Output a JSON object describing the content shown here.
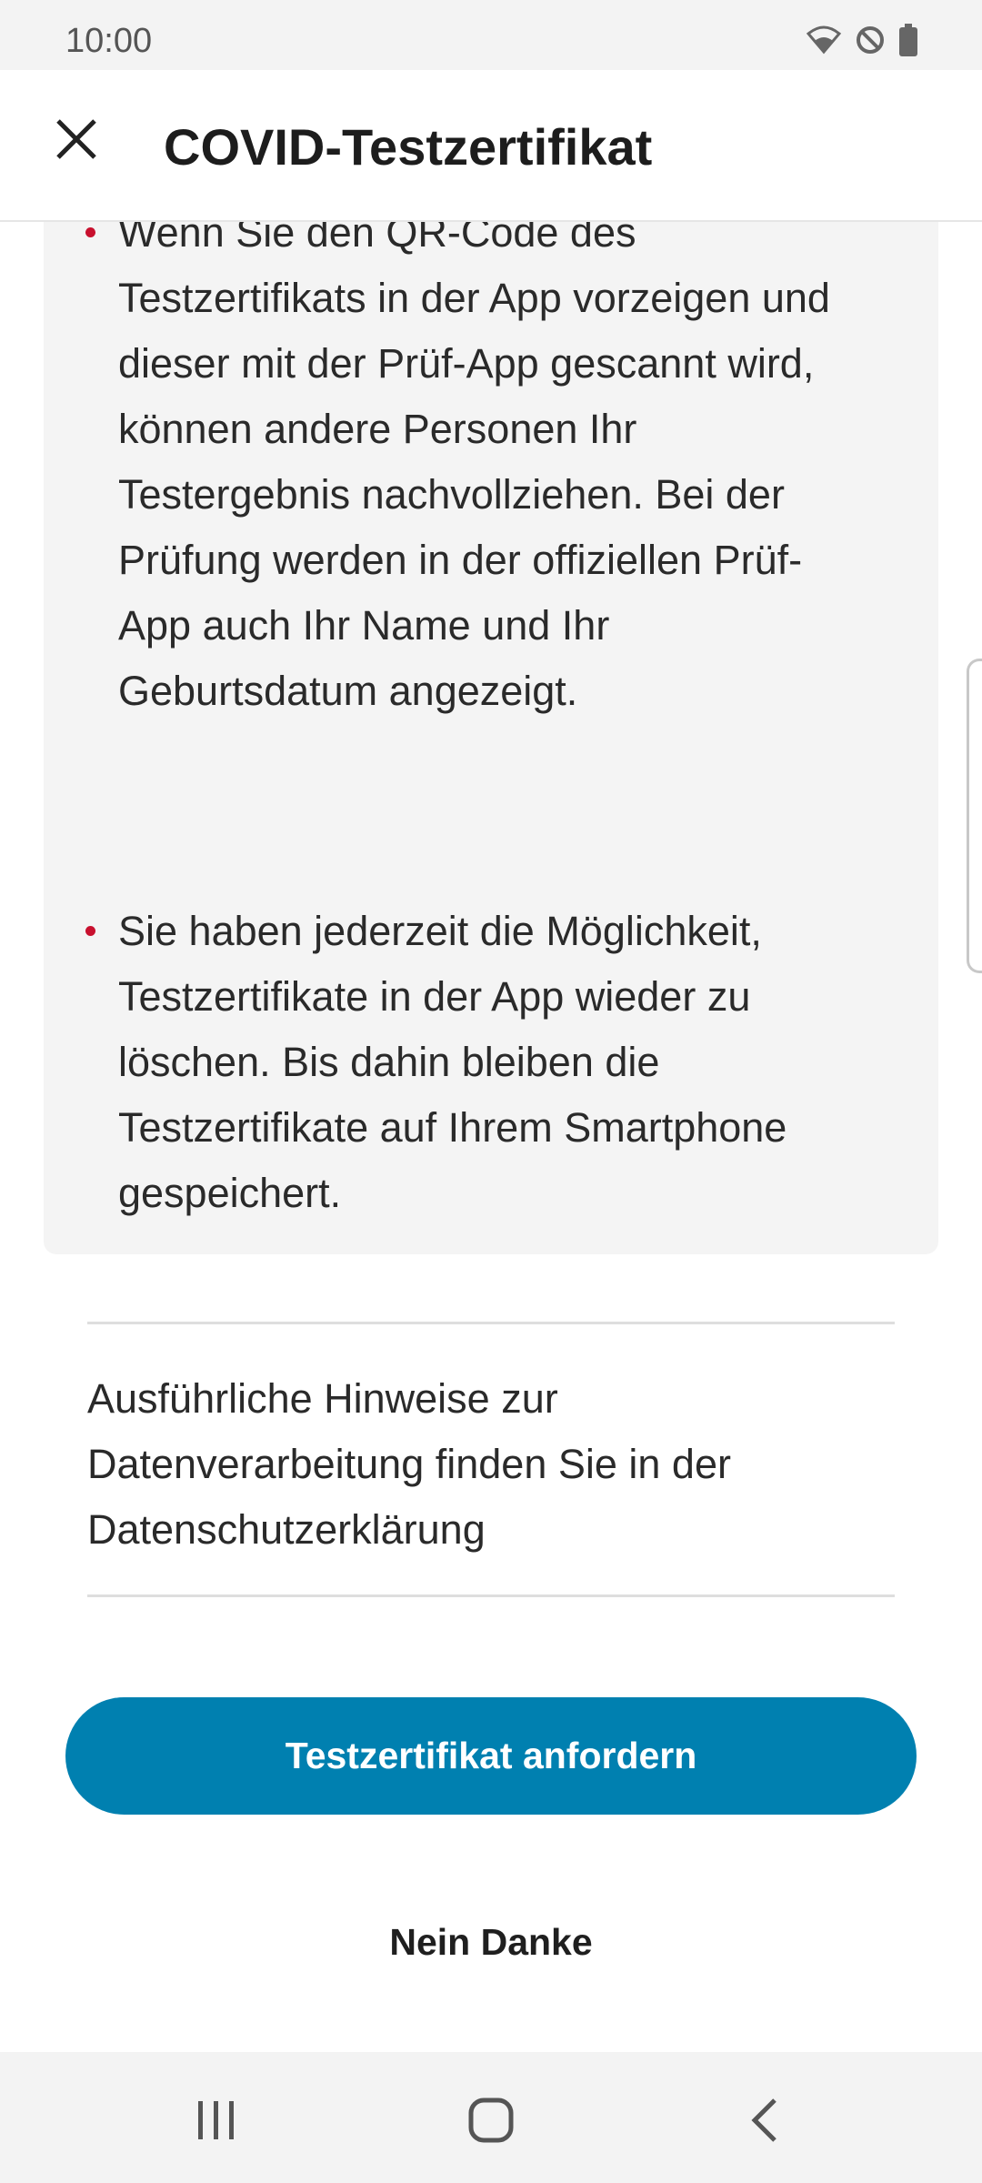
{
  "status_bar": {
    "time": "10:00",
    "icons": [
      "wifi-icon",
      "do-not-disturb-icon",
      "battery-icon"
    ]
  },
  "app_bar": {
    "title": "COVID-Testzertifikat",
    "close_icon": "close-icon"
  },
  "info_box": {
    "bullets": [
      "Wenn Sie den QR-Code des Testzertifikats in der App vorzeigen und dieser mit der Prüf-App gescannt wird, können andere Personen Ihr Testergebnis nachvollziehen. Bei der Prüfung werden in der offiziellen Prüf-App auch Ihr Name und Ihr Geburtsdatum angezeigt.",
      "Sie haben jederzeit die Möglichkeit, Testzertifikate in der App wieder zu löschen. Bis dahin bleiben die Testzertifikate auf Ihrem Smartphone gespeichert."
    ]
  },
  "privacy_link": {
    "text": "Ausführliche Hinweise zur Datenverarbeitung finden Sie in der Datenschutzerklärung"
  },
  "actions": {
    "primary_label": "Testzertifikat anfordern",
    "secondary_label": "Nein Danke"
  },
  "colors": {
    "accent": "#0080b0",
    "bullet": "#c8102e",
    "box_background": "#f4f4f4"
  },
  "nav_bar": {
    "icons": [
      "recent-apps-icon",
      "home-icon",
      "back-icon"
    ]
  }
}
